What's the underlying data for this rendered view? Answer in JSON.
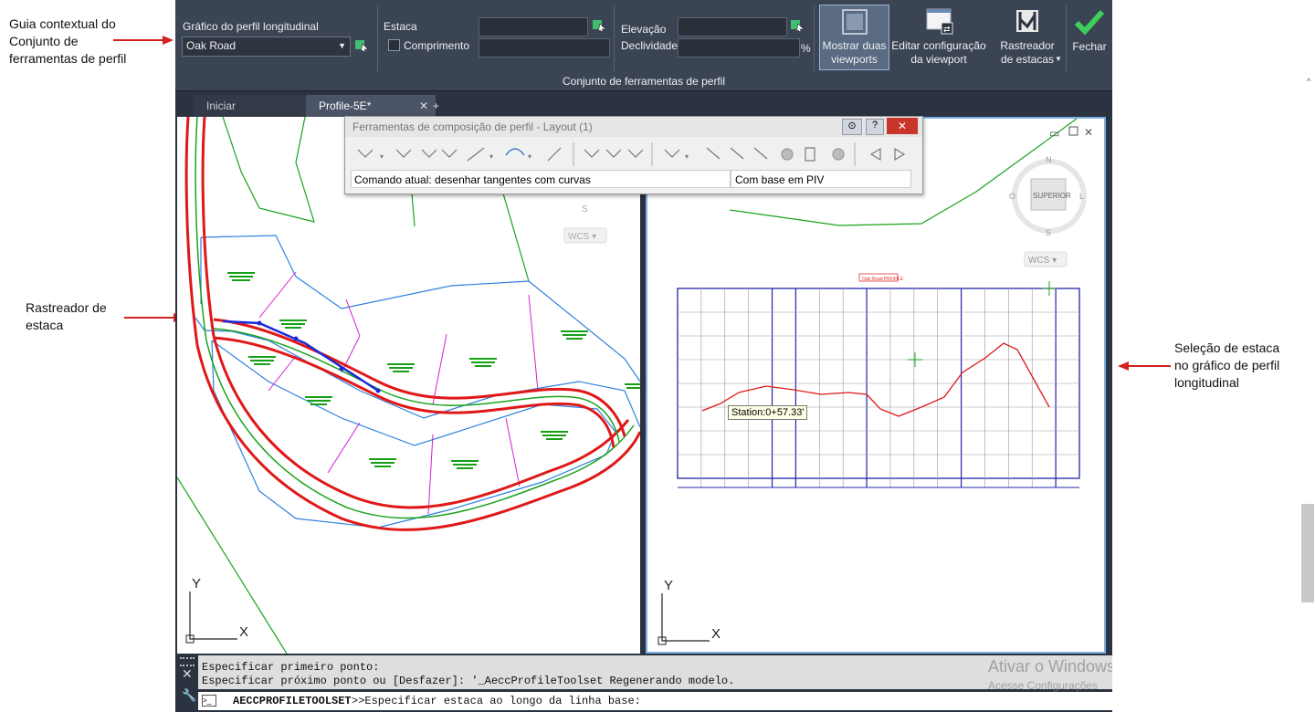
{
  "annotations": {
    "ribbon_guide": "Guia contextual do\nConjunto de\nferramentas de perfil",
    "station_tracker": "Rastreador de\nestaca",
    "station_selection": "Seleção de estaca\nno gráfico de perfil\nlongitudinal"
  },
  "ribbon": {
    "profile_view_label": "Gráfico do perfil longitudinal",
    "profile_view_value": "Oak Road",
    "station_label": "Estaca",
    "length_label": "Comprimento",
    "elevation_label": "Elevação",
    "grade_label": "Declividade",
    "percent": "%",
    "show_two_viewports": "Mostrar duas\nviewports",
    "edit_viewport_config": "Editar configuração\nda viewport",
    "station_tracker_btn": "Rastreador\nde estacas",
    "close": "Fechar",
    "panel_title": "Conjunto de ferramentas de perfil"
  },
  "tabs": [
    {
      "label": "Iniciar"
    },
    {
      "label": "Profile-5E*"
    }
  ],
  "toolbar_window": {
    "title": "Ferramentas de composição de perfil - Layout (1)",
    "current_command": "Comando atual: desenhar tangentes com curvas",
    "mode": "Com base em PIV",
    "help": "?"
  },
  "viewcube": {
    "top": "SUPERIOR",
    "n": "N",
    "s": "S",
    "e": "L",
    "w": "O",
    "wcs": "WCS"
  },
  "profile_view": {
    "title": "Oak Road PROFILE",
    "tooltip": "Station:0+57.33'"
  },
  "ucs": {
    "x": "X",
    "y": "Y"
  },
  "command_line": {
    "line1": "Especificar primeiro ponto:",
    "line2": "Especificar próximo ponto ou [Desfazer]: '_AeccProfileToolset Regenerando modelo.",
    "command": "AECCPROFILETOOLSET",
    "prompt": ">>Especificar estaca ao longo da linha base:"
  },
  "watermark": {
    "line1": "Ativar o Windows",
    "line2": "Acesse Configurações"
  },
  "colors": {
    "ribbon_bg": "#3b4453",
    "app_bg": "#2b3240",
    "arrow": "#d32020",
    "alignment": "#e01818",
    "parcel": "#2f80e0",
    "profile_grid": "#2424a8"
  }
}
